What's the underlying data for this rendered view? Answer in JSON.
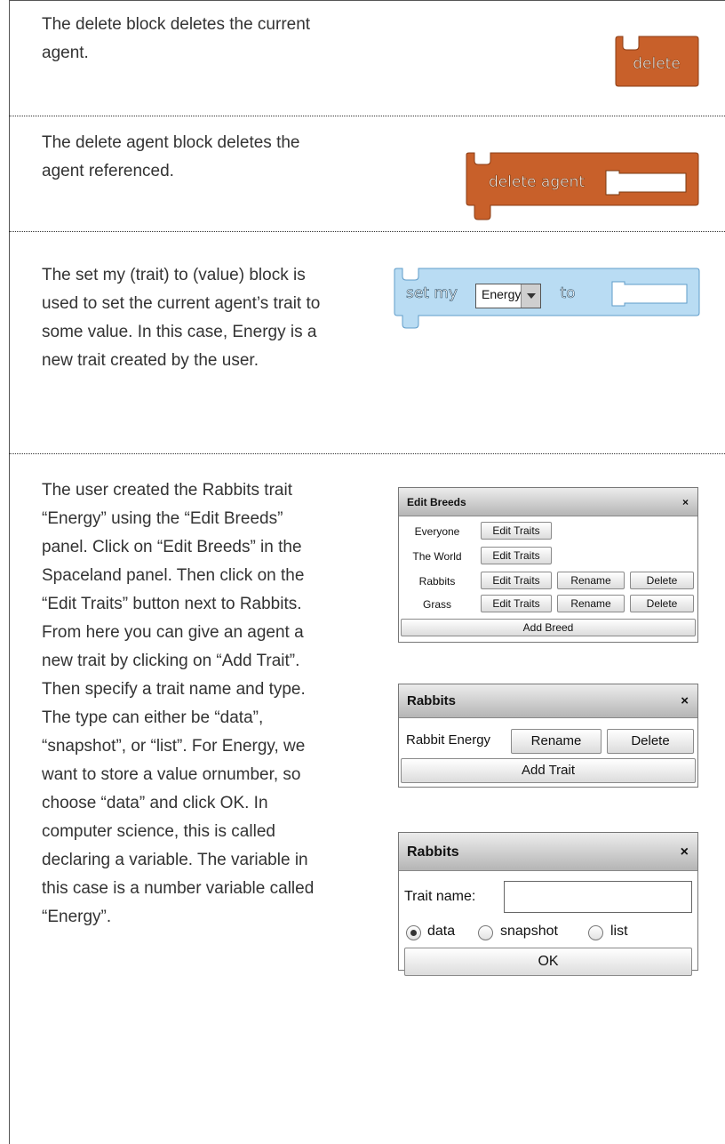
{
  "sections": [
    {
      "text": "The delete block deletes the current agent."
    },
    {
      "text": "The delete agent block deletes the agent referenced."
    },
    {
      "text": "The set my (trait) to (value) block is used to set the current agent’s trait to some value. In this case, Energy is a new trait created by the user."
    },
    {
      "text": "The user created the Rabbits trait “Energy” using the “Edit Breeds” panel. Click on “Edit Breeds” in the Spaceland panel. Then click on the “Edit Traits” button next to Rabbits. From here you can give an agent a new trait by clicking on “Add Trait”. Then specify a trait name and type. The type can either be “data”, “snapshot”, or “list”. For Energy, we want to store a value ornumber, so choose “data” and click OK. In computer science, this is called declaring a variable. The variable in this case is a number variable called “Energy”."
    }
  ],
  "blocks": {
    "delete": {
      "label": "delete",
      "color": "#c8602a"
    },
    "delete_agent": {
      "label": "delete agent",
      "color": "#c8602a"
    },
    "set_my": {
      "label_set": "set my",
      "trait": "Energy",
      "label_to": "to",
      "color": "#b9dcf3"
    }
  },
  "edit_breeds_panel": {
    "title": "Edit Breeds",
    "close": "×",
    "rows": [
      {
        "name": "Everyone",
        "edit": "Edit Traits"
      },
      {
        "name": "The World",
        "edit": "Edit Traits"
      },
      {
        "name": "Rabbits",
        "edit": "Edit Traits",
        "rename": "Rename",
        "delete": "Delete"
      },
      {
        "name": "Grass",
        "edit": "Edit Traits",
        "rename": "Rename",
        "delete": "Delete"
      }
    ],
    "add": "Add Breed"
  },
  "traits_panel": {
    "title": "Rabbits",
    "close": "×",
    "trait_name": "Rabbit Energy",
    "rename": "Rename",
    "delete": "Delete",
    "add": "Add Trait"
  },
  "new_trait_panel": {
    "title": "Rabbits",
    "close": "×",
    "field_label": "Trait name:",
    "field_value": "",
    "options": [
      "data",
      "snapshot",
      "list"
    ],
    "selected": "data",
    "ok": "OK"
  }
}
